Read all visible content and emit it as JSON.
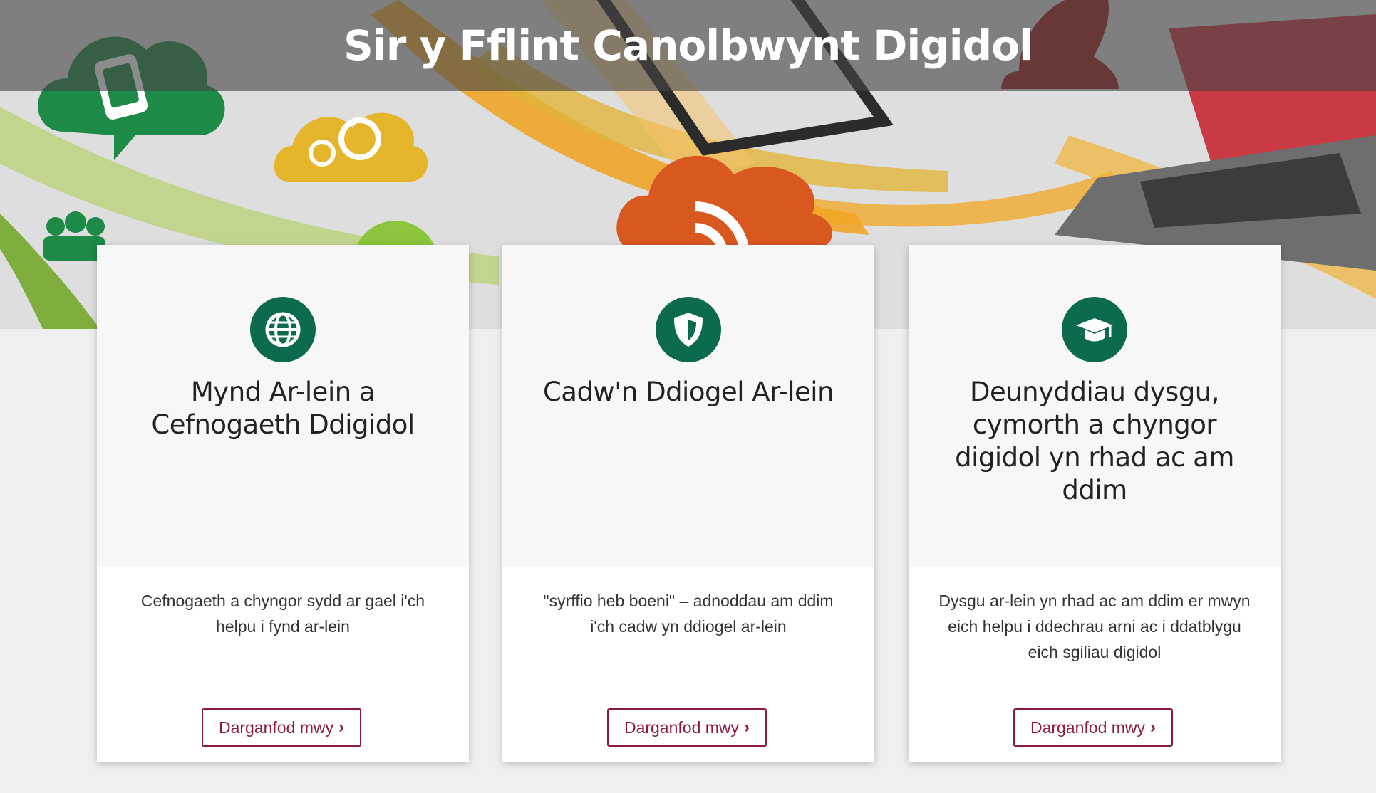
{
  "header": {
    "title": "Sir y Fflint Canolbwynt Digidol"
  },
  "hero": {
    "decorative_icons": [
      "phone-cloud-icon",
      "gears-cloud-icon",
      "rss-cloud-icon",
      "people-icon",
      "laptop-icon",
      "tablet-icon",
      "chess-piece-icon"
    ],
    "colors": [
      "#1d8a48",
      "#e5b52c",
      "#d9581f",
      "#9a2a22"
    ]
  },
  "cards": [
    {
      "icon": "globe-icon",
      "heading": "Mynd Ar-lein a Cefnogaeth Ddigidol",
      "text": "Cefnogaeth a chyngor sydd ar gael i'ch helpu i fynd ar-lein",
      "button": "Darganfod mwy"
    },
    {
      "icon": "shield-icon",
      "heading": "Cadw'n Ddiogel Ar-lein",
      "text": "\"syrffio heb boeni\" – adnoddau am ddim i'ch cadw yn ddiogel ar-lein",
      "button": "Darganfod mwy"
    },
    {
      "icon": "graduation-cap-icon",
      "heading": "Deunyddiau dysgu, cymorth a chyngor digidol yn rhad ac am ddim",
      "text": "Dysgu ar-lein yn rhad ac am ddim er mwyn eich helpu i ddechrau arni ac i ddatblygu eich sgiliau digidol",
      "button": "Darganfod mwy"
    }
  ],
  "theme": {
    "icon_circle": "#0c6a4e",
    "button_accent": "#8c1a3c"
  }
}
